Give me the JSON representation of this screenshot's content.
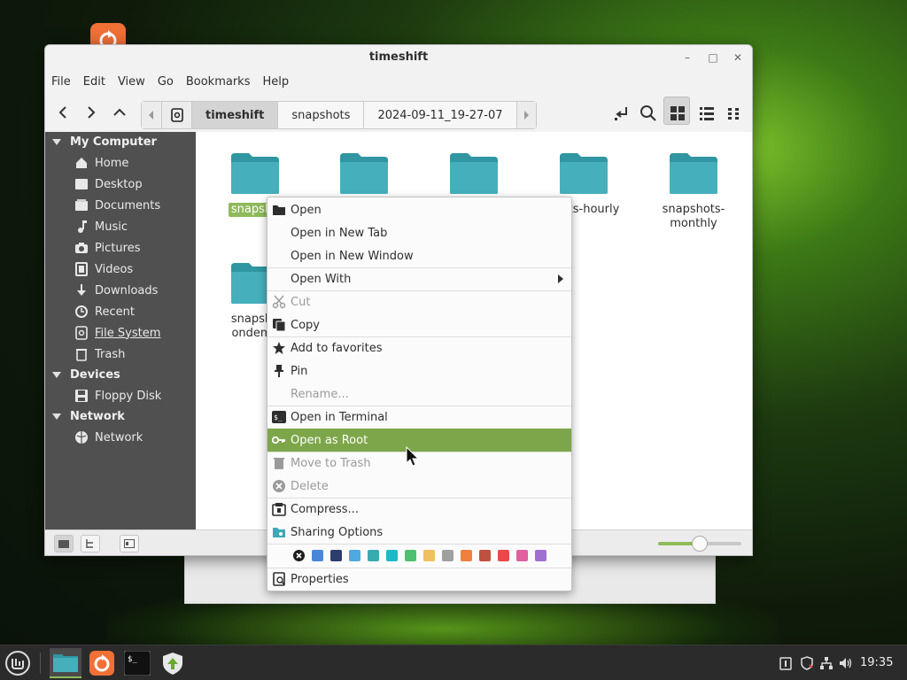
{
  "window": {
    "title": "timeshift",
    "menus": [
      "File",
      "Edit",
      "View",
      "Go",
      "Bookmarks",
      "Help"
    ],
    "path": [
      "timeshift",
      "snapshots",
      "2024-09-11_19-27-07"
    ]
  },
  "sidebar": {
    "sections": [
      {
        "label": "My Computer",
        "items": [
          {
            "label": "Home",
            "icon": "home-icon"
          },
          {
            "label": "Desktop",
            "icon": "desktop-icon"
          },
          {
            "label": "Documents",
            "icon": "documents-icon"
          },
          {
            "label": "Music",
            "icon": "music-icon"
          },
          {
            "label": "Pictures",
            "icon": "pictures-icon"
          },
          {
            "label": "Videos",
            "icon": "videos-icon"
          },
          {
            "label": "Downloads",
            "icon": "downloads-icon"
          },
          {
            "label": "Recent",
            "icon": "recent-icon"
          },
          {
            "label": "File System",
            "icon": "filesystem-icon"
          },
          {
            "label": "Trash",
            "icon": "trash-icon"
          }
        ]
      },
      {
        "label": "Devices",
        "items": [
          {
            "label": "Floppy Disk",
            "icon": "floppy-icon"
          }
        ]
      },
      {
        "label": "Network",
        "items": [
          {
            "label": "Network",
            "icon": "network-icon"
          }
        ]
      }
    ]
  },
  "folders": [
    {
      "label": "snapsho"
    },
    {
      "label": ""
    },
    {
      "label": ""
    },
    {
      "label": "shots-hourly"
    },
    {
      "label": "snapshots-\nmonthly"
    },
    {
      "label": "snapsho\nondema"
    }
  ],
  "context_menu": {
    "items": [
      {
        "label": "Open",
        "icon": "folder-open-icon"
      },
      {
        "label": "Open in New Tab"
      },
      {
        "label": "Open in New Window"
      },
      {
        "label": "Open With",
        "submenu": true
      },
      {
        "label": "Cut",
        "icon": "scissors-icon",
        "disabled": true
      },
      {
        "label": "Copy",
        "icon": "copy-icon"
      },
      {
        "label": "Add to favorites",
        "icon": "star-icon"
      },
      {
        "label": "Pin",
        "icon": "pin-icon"
      },
      {
        "label": "Rename...",
        "disabled": true
      },
      {
        "label": "Open in Terminal",
        "icon": "terminal-icon"
      },
      {
        "label": "Open as Root",
        "icon": "key-icon",
        "highlighted": true
      },
      {
        "label": "Move to Trash",
        "icon": "trash-icon",
        "disabled": true
      },
      {
        "label": "Delete",
        "icon": "delete-icon",
        "disabled": true
      },
      {
        "label": "Compress...",
        "icon": "compress-icon"
      },
      {
        "label": "Sharing Options",
        "icon": "share-icon"
      },
      {
        "label": "Properties",
        "icon": "properties-icon"
      }
    ],
    "emblem_colors": [
      "#4a86d8",
      "#2c3e6c",
      "#4fa8e0",
      "#3aaab0",
      "#1fb8c8",
      "#4cc070",
      "#f0c060",
      "#a0a0a0",
      "#f08040",
      "#c05040",
      "#e84848",
      "#e060a0",
      "#a070d0"
    ]
  },
  "status": {
    "zoom_fraction": 0.5
  },
  "taskbar": {
    "clock": "19:35"
  },
  "colors": {
    "accent": "#8fba5a",
    "folder": "#3fa9b5",
    "sidebar_bg": "#505050"
  }
}
